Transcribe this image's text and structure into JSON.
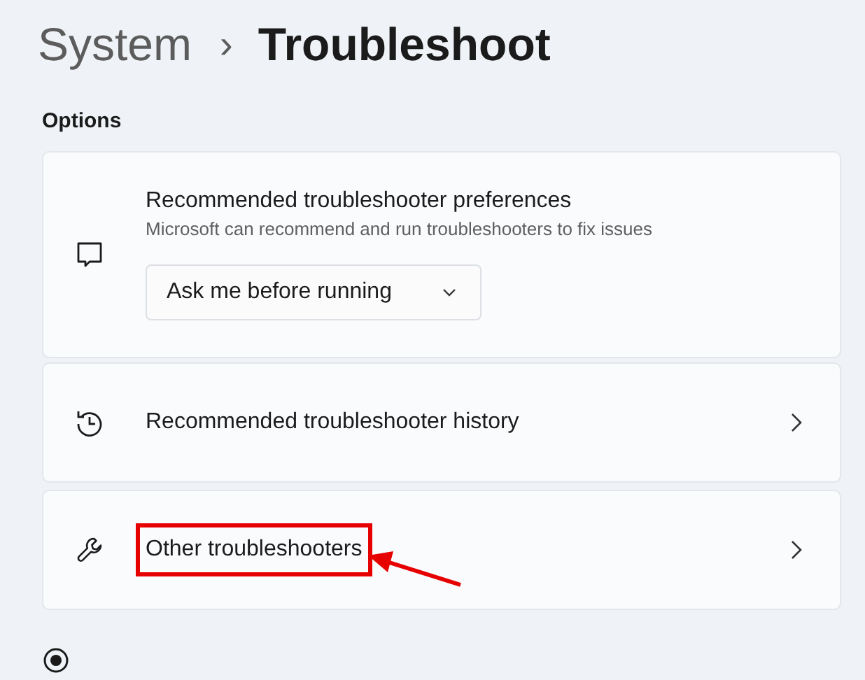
{
  "breadcrumb": {
    "parent": "System",
    "separator": "›",
    "current": "Troubleshoot"
  },
  "section_label": "Options",
  "options": [
    {
      "kind": "dropdown",
      "title": "Recommended troubleshooter preferences",
      "description": "Microsoft can recommend and run troubleshooters to fix issues",
      "dropdown_value": "Ask me before running",
      "highlighted": false
    },
    {
      "kind": "link",
      "title": "Recommended troubleshooter history",
      "highlighted": false
    },
    {
      "kind": "link",
      "title": "Other troubleshooters",
      "highlighted": true
    }
  ]
}
